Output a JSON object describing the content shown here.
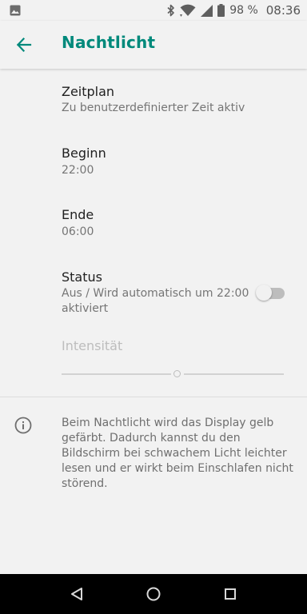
{
  "status_bar": {
    "battery": "98 %",
    "time": "08:36",
    "icons": [
      "image-icon",
      "bluetooth-icon",
      "wifi-icon",
      "signal-icon",
      "battery-icon"
    ]
  },
  "app_bar": {
    "title": "Nachtlicht",
    "back_icon": "arrow-back-icon",
    "accent_color": "#00897b"
  },
  "prefs": {
    "schedule": {
      "title": "Zeitplan",
      "summary": "Zu benutzerdefinierter Zeit aktiv"
    },
    "start": {
      "title": "Beginn",
      "summary": "22:00"
    },
    "end": {
      "title": "Ende",
      "summary": "06:00"
    },
    "status": {
      "title": "Status",
      "summary_line1": "Aus / Wird automatisch um 22:00",
      "summary_line2": "aktiviert",
      "toggle_on": false
    },
    "intensity": {
      "title": "Intensität",
      "enabled": false,
      "value": 0.52
    }
  },
  "info": {
    "icon": "info-icon",
    "text": "Beim Nachtlicht wird das Display gelb gefärbt. Dadurch kannst du den Bildschirm bei schwachem Licht leichter lesen und er wirkt beim Einschlafen nicht störend."
  },
  "nav_bar": {
    "buttons": [
      "back-triangle-icon",
      "home-circle-icon",
      "overview-square-icon"
    ]
  }
}
